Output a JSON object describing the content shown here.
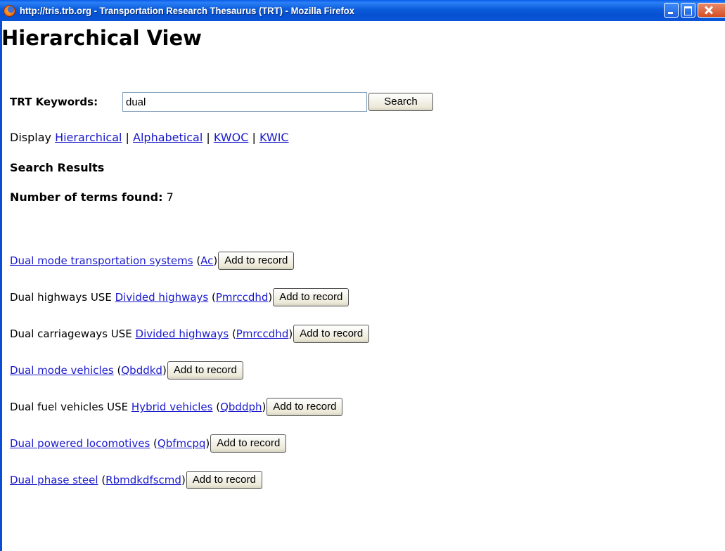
{
  "window": {
    "title": "http://tris.trb.org - Transportation Research Thesaurus (TRT) - Mozilla Firefox"
  },
  "page": {
    "heading": "Hierarchical View",
    "keyword_label": "TRT Keywords:",
    "keyword_value": "dual",
    "search_button": "Search",
    "display_label": "Display",
    "display_links": [
      "Hierarchical",
      "Alphabetical",
      "KWOC",
      "KWIC"
    ],
    "separator": "|",
    "results_heading": "Search Results",
    "count_label": "Number of terms found:",
    "count_value": "7",
    "add_button": "Add to record"
  },
  "results": [
    {
      "term": "Dual mode transportation systems",
      "use": "",
      "target": "",
      "code": "Ac",
      "term_is_link": true
    },
    {
      "term": "Dual highways",
      "use": "USE",
      "target": "Divided highways",
      "code": "Pmrccdhd",
      "term_is_link": false
    },
    {
      "term": "Dual carriageways",
      "use": "USE",
      "target": "Divided highways",
      "code": "Pmrccdhd",
      "term_is_link": false
    },
    {
      "term": "Dual mode vehicles",
      "use": "",
      "target": "",
      "code": "Qbddkd",
      "term_is_link": true
    },
    {
      "term": "Dual fuel vehicles",
      "use": "USE",
      "target": "Hybrid vehicles",
      "code": "Qbddph",
      "term_is_link": false
    },
    {
      "term": "Dual powered locomotives",
      "use": "",
      "target": "",
      "code": "Qbfmcpq",
      "term_is_link": true
    },
    {
      "term": "Dual phase steel",
      "use": "",
      "target": "",
      "code": "Rbmdkdfscmd",
      "term_is_link": true
    }
  ]
}
